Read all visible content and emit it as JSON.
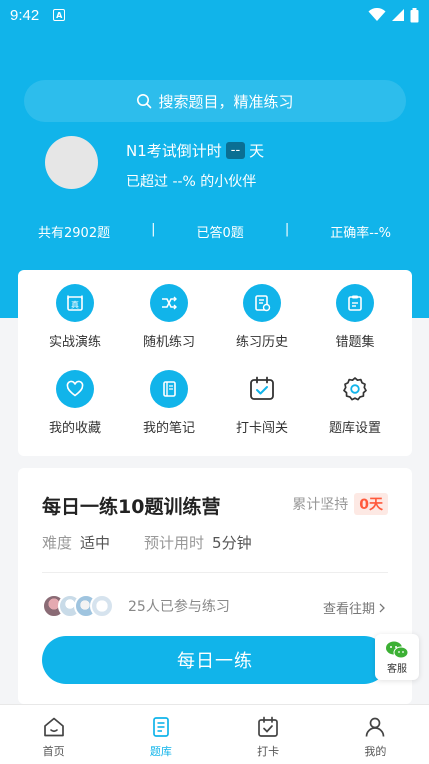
{
  "status": {
    "time": "9:42"
  },
  "search": {
    "placeholder": "搜索题目，精准练习"
  },
  "profile": {
    "countdown_label": "N1考试倒计时",
    "countdown_days": "--",
    "countdown_unit": "天",
    "surpass_text": "已超过 --% 的小伙伴"
  },
  "stats": {
    "total": "共有2902题",
    "sep1": "|",
    "answered": "已答0题",
    "sep2": "|",
    "accuracy": "正确率--%"
  },
  "grid": [
    {
      "label": "实战演练",
      "icon": "exam-icon"
    },
    {
      "label": "随机练习",
      "icon": "shuffle-icon"
    },
    {
      "label": "练习历史",
      "icon": "history-icon"
    },
    {
      "label": "错题集",
      "icon": "wrong-book-icon"
    },
    {
      "label": "我的收藏",
      "icon": "heart-icon"
    },
    {
      "label": "我的笔记",
      "icon": "notebook-icon"
    },
    {
      "label": "打卡闯关",
      "icon": "calendar-check-icon"
    },
    {
      "label": "题库设置",
      "icon": "gear-icon"
    }
  ],
  "daily": {
    "title": "每日一练10题训练营",
    "persist_label": "累计坚持",
    "streak": "0天",
    "difficulty_label": "难度",
    "difficulty_value": "适中",
    "time_label": "预计用时",
    "time_value": "5分钟",
    "participants": "25人已参与练习",
    "history_link": "查看往期",
    "button": "每日一练"
  },
  "service": {
    "label": "客服"
  },
  "tabs": [
    {
      "label": "首页",
      "icon": "home-icon",
      "active": false
    },
    {
      "label": "题库",
      "icon": "question-bank-icon",
      "active": true
    },
    {
      "label": "打卡",
      "icon": "checkin-icon",
      "active": false
    },
    {
      "label": "我的",
      "icon": "user-icon",
      "active": false
    }
  ],
  "colors": {
    "accent": "#11b4ea",
    "streak": "#ff5a3c"
  }
}
